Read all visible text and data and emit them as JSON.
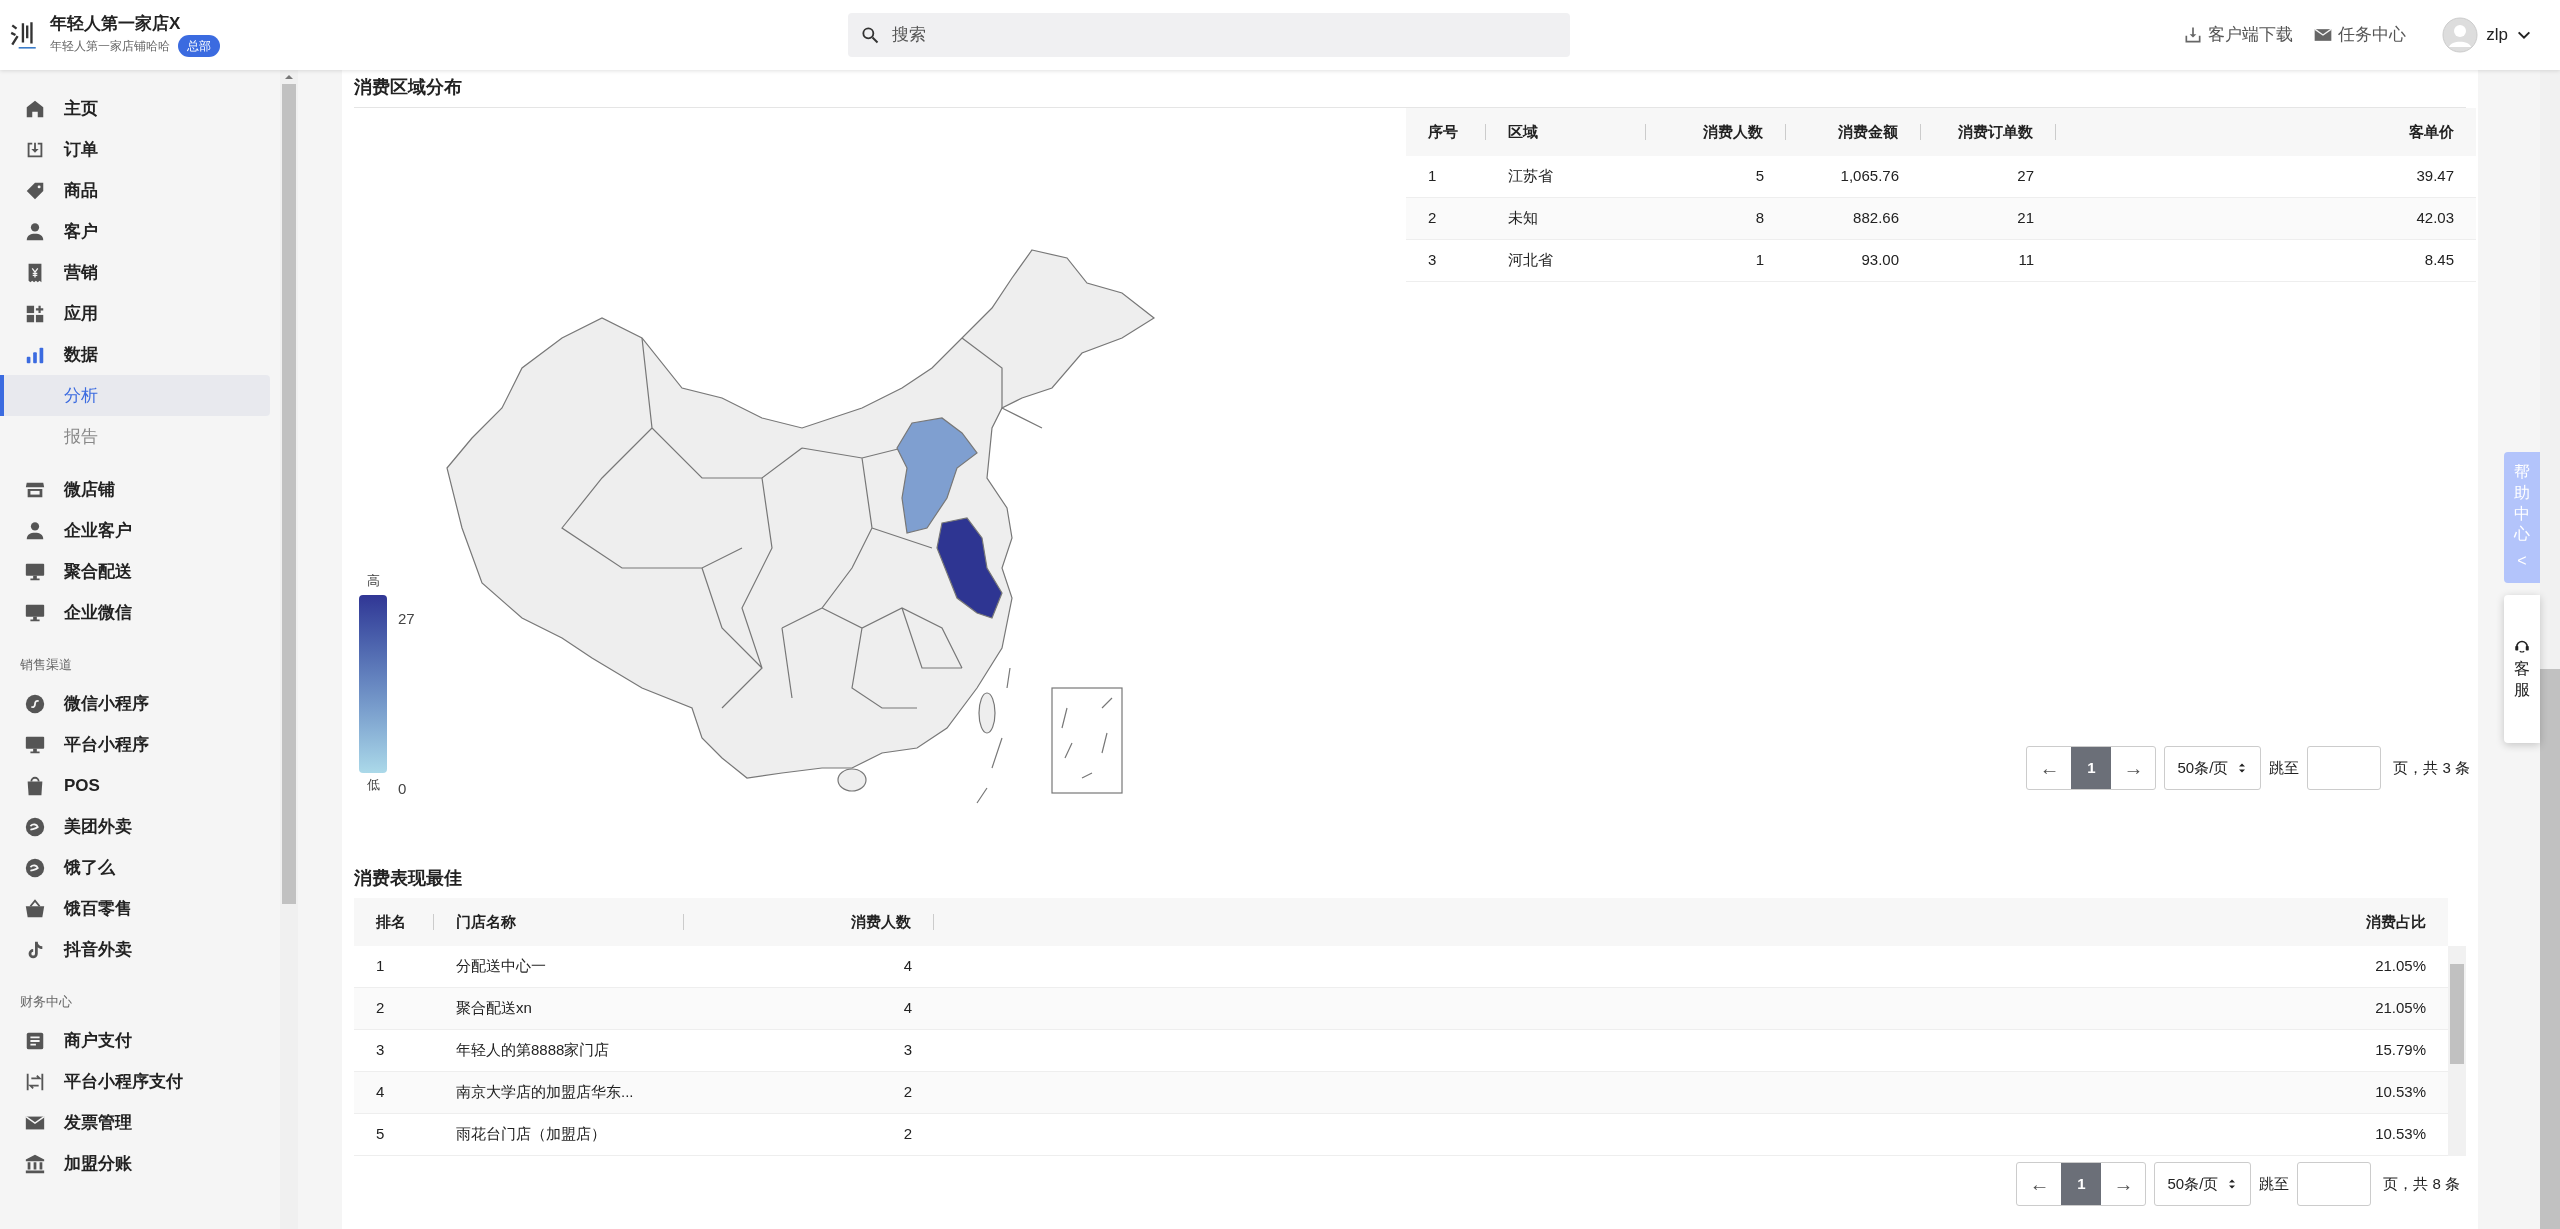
{
  "header": {
    "brand": {
      "title": "年轻人第一家店X",
      "subtitle": "年轻人第一家店铺哈哈",
      "badge": "总部"
    },
    "search": {
      "placeholder": "搜索"
    },
    "actions": [
      {
        "label": "客户端下载",
        "kind": "download"
      },
      {
        "label": "任务中心",
        "kind": "mail"
      }
    ],
    "user": {
      "name": "zlp"
    }
  },
  "sidebar": {
    "groups": [
      {
        "items": [
          {
            "label": "主页",
            "kind": "home",
            "selected": false
          },
          {
            "label": "订单",
            "kind": "inbox",
            "selected": false
          },
          {
            "label": "商品",
            "kind": "tag",
            "selected": false
          },
          {
            "label": "客户",
            "kind": "person",
            "selected": false
          },
          {
            "label": "营销",
            "kind": "receipt",
            "selected": false
          },
          {
            "label": "应用",
            "kind": "apps",
            "selected": false
          },
          {
            "label": "数据",
            "kind": "bars",
            "selected": false,
            "children": [
              {
                "label": "分析",
                "selected": true
              },
              {
                "label": "报告",
                "selected": false
              }
            ]
          },
          {
            "label": "微店铺",
            "kind": "store",
            "selected": false
          },
          {
            "label": "企业客户",
            "kind": "person",
            "selected": false
          },
          {
            "label": "聚合配送",
            "kind": "monitor",
            "selected": false
          },
          {
            "label": "企业微信",
            "kind": "monitor",
            "selected": false
          }
        ]
      },
      {
        "title": "销售渠道",
        "items": [
          {
            "label": "微信小程序",
            "kind": "link",
            "selected": false
          },
          {
            "label": "平台小程序",
            "kind": "monitor",
            "selected": false
          },
          {
            "label": "POS",
            "kind": "bag",
            "selected": false
          },
          {
            "label": "美团外卖",
            "kind": "circle",
            "selected": false
          },
          {
            "label": "饿了么",
            "kind": "circle",
            "selected": false
          },
          {
            "label": "饿百零售",
            "kind": "basket",
            "selected": false
          },
          {
            "label": "抖音外卖",
            "kind": "note",
            "selected": false
          }
        ]
      },
      {
        "title": "财务中心",
        "items": [
          {
            "label": "商户支付",
            "kind": "doc",
            "selected": false
          },
          {
            "label": "平台小程序支付",
            "kind": "swap",
            "selected": false
          },
          {
            "label": "发票管理",
            "kind": "mail",
            "selected": false
          },
          {
            "label": "加盟分账",
            "kind": "bank",
            "selected": false
          }
        ]
      }
    ]
  },
  "region_section": {
    "title": "消费区域分布",
    "legend": {
      "high_label": "高",
      "max": "27",
      "min": "0",
      "low_label": "低"
    },
    "table": {
      "columns": [
        "序号",
        "区域",
        "消费人数",
        "消费金额",
        "消费订单数",
        "客单价"
      ],
      "rows": [
        [
          "1",
          "江苏省",
          "5",
          "1,065.76",
          "27",
          "39.47"
        ],
        [
          "2",
          "未知",
          "8",
          "882.66",
          "21",
          "42.03"
        ],
        [
          "3",
          "河北省",
          "1",
          "93.00",
          "11",
          "8.45"
        ]
      ]
    },
    "pagination": {
      "prev": "←",
      "pages": [
        {
          "label": "1",
          "selected": true
        }
      ],
      "next": "→",
      "page_size": "50条/页",
      "jump_label": "跳至",
      "total": "页，共 3 条"
    }
  },
  "store_section": {
    "title": "消费表现最佳",
    "table": {
      "columns": [
        "排名",
        "门店名称",
        "消费人数",
        "消费占比"
      ],
      "rows": [
        [
          "1",
          "分配送中心一",
          "4",
          "21.05%"
        ],
        [
          "2",
          "聚合配送xn",
          "4",
          "21.05%"
        ],
        [
          "3",
          "年轻人的第8888家门店",
          "3",
          "15.79%"
        ],
        [
          "4",
          "南京大学店的加盟店华东...",
          "2",
          "10.53%"
        ],
        [
          "5",
          "雨花台门店（加盟店）",
          "2",
          "10.53%"
        ]
      ]
    },
    "pagination": {
      "prev": "←",
      "pages": [
        {
          "label": "1",
          "selected": true
        }
      ],
      "next": "→",
      "page_size": "50条/页",
      "jump_label": "跳至",
      "total": "页，共 8 条"
    }
  },
  "help": {
    "title": "帮助中心",
    "collapse": "<",
    "service": "客服"
  }
}
